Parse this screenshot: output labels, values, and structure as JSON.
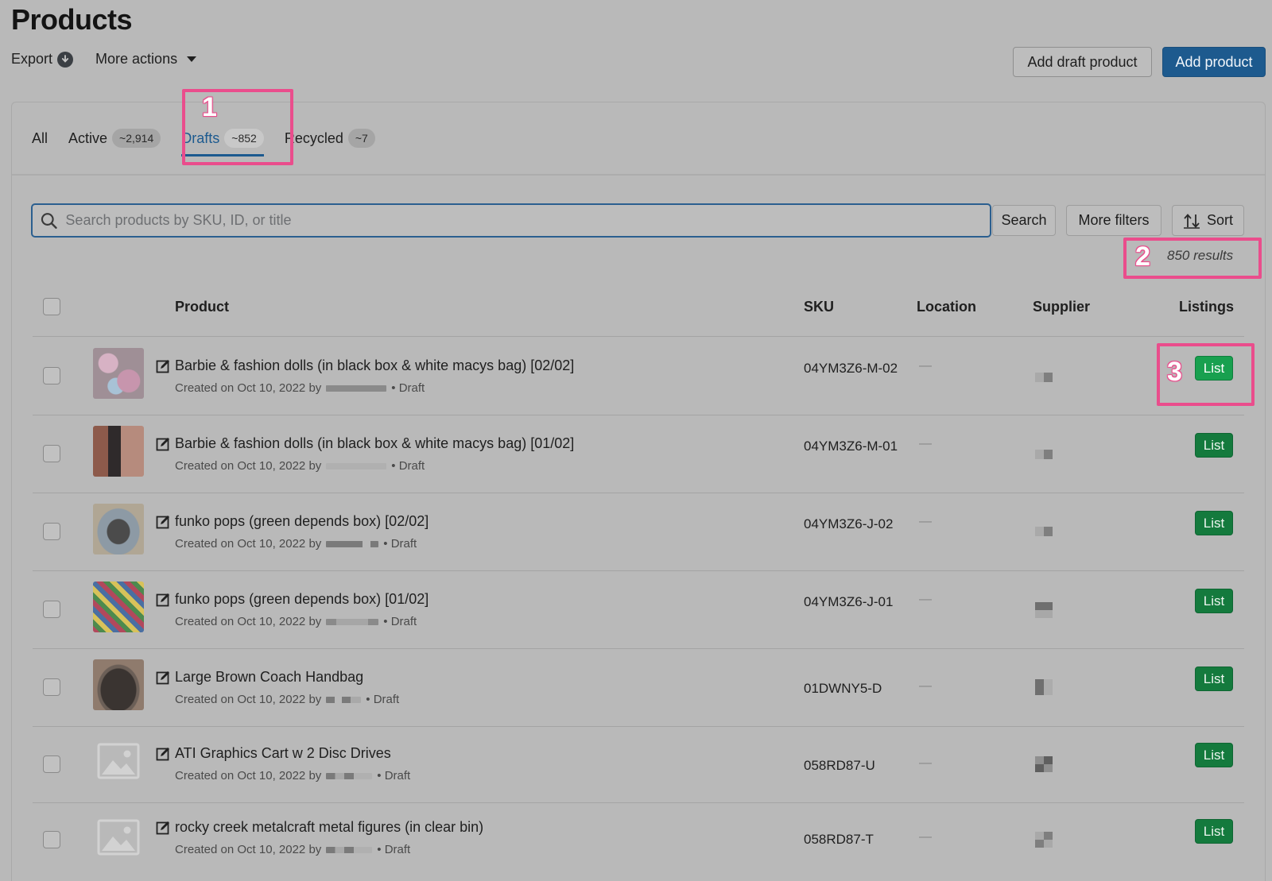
{
  "header": {
    "title": "Products",
    "export_label": "Export",
    "more_actions_label": "More actions",
    "add_draft_label": "Add draft product",
    "add_product_label": "Add product"
  },
  "tabs": [
    {
      "label": "All",
      "count": ""
    },
    {
      "label": "Active",
      "count": "~2,914"
    },
    {
      "label": "Drafts",
      "count": "~852"
    },
    {
      "label": "Recycled",
      "count": "~7"
    }
  ],
  "search": {
    "placeholder": "Search products by SKU, ID, or title",
    "button_label": "Search",
    "filters_label": "More filters",
    "sort_label": "Sort",
    "results_text": "850 results"
  },
  "annotations": [
    "1",
    "2",
    "3"
  ],
  "table": {
    "columns": [
      "Product",
      "SKU",
      "Location",
      "Supplier",
      "Listings"
    ],
    "rows": [
      {
        "title": "Barbie & fashion dolls (in black box & white macys bag) [02/02]",
        "created": "Created on Oct 10, 2022 by",
        "status": "• Draft",
        "sku": "04YM3Z6-M-02",
        "location": "—",
        "action": "List"
      },
      {
        "title": "Barbie & fashion dolls (in black box & white macys bag) [01/02]",
        "created": "Created on Oct 10, 2022 by",
        "status": "• Draft",
        "sku": "04YM3Z6-M-01",
        "location": "—",
        "action": "List"
      },
      {
        "title": "funko pops (green depends box) [02/02]",
        "created": "Created on Oct 10, 2022 by",
        "status": "• Draft",
        "sku": "04YM3Z6-J-02",
        "location": "—",
        "action": "List"
      },
      {
        "title": "funko pops (green depends box) [01/02]",
        "created": "Created on Oct 10, 2022 by",
        "status": "• Draft",
        "sku": "04YM3Z6-J-01",
        "location": "—",
        "action": "List"
      },
      {
        "title": "Large Brown Coach Handbag",
        "created": "Created on Oct 10, 2022 by",
        "status": "• Draft",
        "sku": "01DWNY5-D",
        "location": "—",
        "action": "List"
      },
      {
        "title": "ATI Graphics Cart w 2 Disc Drives",
        "created": "Created on Oct 10, 2022 by",
        "status": "• Draft",
        "sku": "058RD87-U",
        "location": "—",
        "action": "List"
      },
      {
        "title": "rocky creek metalcraft metal figures (in clear bin)",
        "created": "Created on Oct 10, 2022 by",
        "status": "• Draft",
        "sku": "058RD87-T",
        "location": "—",
        "action": "List"
      }
    ]
  },
  "colors": {
    "accent": "#1d5a8e",
    "highlight": "#ea4d8c",
    "list_button": "#147a3d"
  },
  "icons": [
    "export-icon",
    "chevron-down-icon",
    "search-icon",
    "sort-icon",
    "edit-icon",
    "image-placeholder-icon"
  ]
}
